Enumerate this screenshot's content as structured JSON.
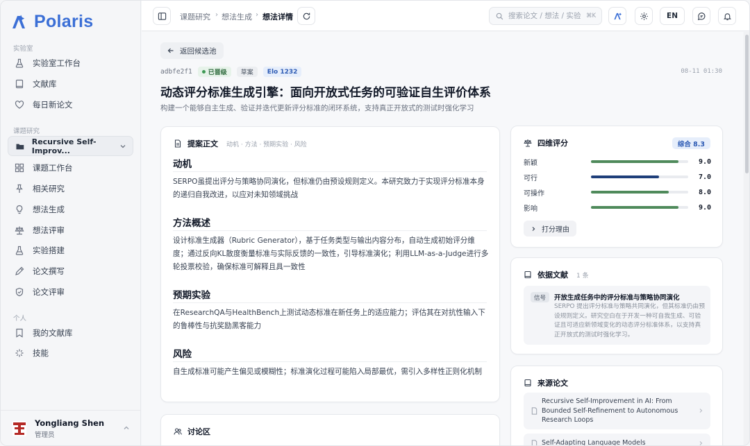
{
  "app": {
    "name": "Polaris"
  },
  "sidebar": {
    "sections": {
      "lab": "实验室",
      "research": "课题研究",
      "personal": "个人"
    },
    "lab_items": [
      {
        "label": "实验室工作台",
        "icon": "flask-icon"
      },
      {
        "label": "文献库",
        "icon": "book-icon"
      },
      {
        "label": "每日新论文",
        "icon": "heart-icon"
      }
    ],
    "project_selector": "Recursive Self-Improv...",
    "research_items": [
      {
        "label": "课题工作台",
        "icon": "grid-icon"
      },
      {
        "label": "相关研究",
        "icon": "pin-icon"
      },
      {
        "label": "想法生成",
        "icon": "bulb-icon"
      },
      {
        "label": "想法评审",
        "icon": "scale-icon"
      },
      {
        "label": "实验搭建",
        "icon": "flask-icon"
      },
      {
        "label": "论文撰写",
        "icon": "pen-icon"
      },
      {
        "label": "论文评审",
        "icon": "shield-icon"
      }
    ],
    "personal_items": [
      {
        "label": "我的文献库",
        "icon": "bookmark-icon"
      },
      {
        "label": "技能",
        "icon": "sparkle-icon"
      }
    ],
    "user": {
      "name": "Yongliang Shen",
      "role": "管理员"
    }
  },
  "topbar": {
    "breadcrumb": [
      "课题研究",
      "想法生成",
      "想法详情"
    ],
    "search_placeholder": "搜索论文 / 想法 / 实验...",
    "search_shortcut": "⌘K",
    "lang": "EN"
  },
  "idea": {
    "back_label": "返回候选池",
    "id": "adbfe2f1",
    "status": "已晋级",
    "draft": "草案",
    "elo": "Elo 1232",
    "timestamp": "08-11 01:30",
    "title": "动态评分标准生成引擎：面向开放式任务的可验证自生评价体系",
    "subtitle": "构建一个能够自主生成、验证并迭代更新评分标准的闭环系统，支持真正开放式的测试时强化学习"
  },
  "proposal": {
    "title": "提案正文",
    "hint": "动机 · 方法 · 预期实验 · 风险",
    "sections": [
      {
        "heading": "动机",
        "body": "SERPO虽提出评分与策略协同演化，但标准仍由预设规则定义。本研究致力于实现评分标准本身的递归自我改进，以应对未知领域挑战"
      },
      {
        "heading": "方法概述",
        "body": "设计标准生成器（Rubric Generator），基于任务类型与输出内容分布，自动生成初始评分维度；通过反向KL散度衡量标准与实际反馈的一致性，引导标准演化；利用LLM-as-a-Judge进行多轮投票校验，确保标准可解释且具一致性"
      },
      {
        "heading": "预期实验",
        "body": "在ResearchQA与HealthBench上测试动态标准在新任务上的适应能力；评估其在对抗性输入下的鲁棒性与抗奖励黑客能力"
      },
      {
        "heading": "风险",
        "body": "自生成标准可能产生偏见或模糊性；标准演化过程可能陷入局部最优，需引入多样性正则化机制"
      }
    ]
  },
  "discussion": {
    "title": "讨论区"
  },
  "scores": {
    "title": "四维评分",
    "overall": "综合 8.3",
    "items": [
      {
        "label": "新颖",
        "value": 9.0,
        "display": "9.0",
        "color": "#4f8a5b"
      },
      {
        "label": "可行",
        "value": 7.0,
        "display": "7.0",
        "color": "#1f3f7a"
      },
      {
        "label": "可操作",
        "value": 8.0,
        "display": "8.0",
        "color": "#4f8a5b"
      },
      {
        "label": "影响",
        "value": 9.0,
        "display": "9.0",
        "color": "#4f8a5b"
      }
    ],
    "max": 10,
    "reason_label": "打分理由"
  },
  "references": {
    "title": "依据文献",
    "count": "1 条",
    "items": [
      {
        "tag": "信号",
        "title": "开放生成任务中的评分标准与策略协同演化",
        "desc": "SERPO 提出评分标准与策略共同演化，但其标准仍由预设规则定义。研究空白在于开发一种可自我生成、可验证且可适应新领域变化的动态评分标准体系，以支持真正开放式的测试时强化学习。"
      }
    ]
  },
  "source_papers": {
    "title": "来源论文",
    "items": [
      {
        "title": "Recursive Self-Improvement in AI: From Bounded Self-Refinement to Autonomous Research Loops"
      },
      {
        "title": "Self-Adapting Language Models"
      }
    ]
  }
}
